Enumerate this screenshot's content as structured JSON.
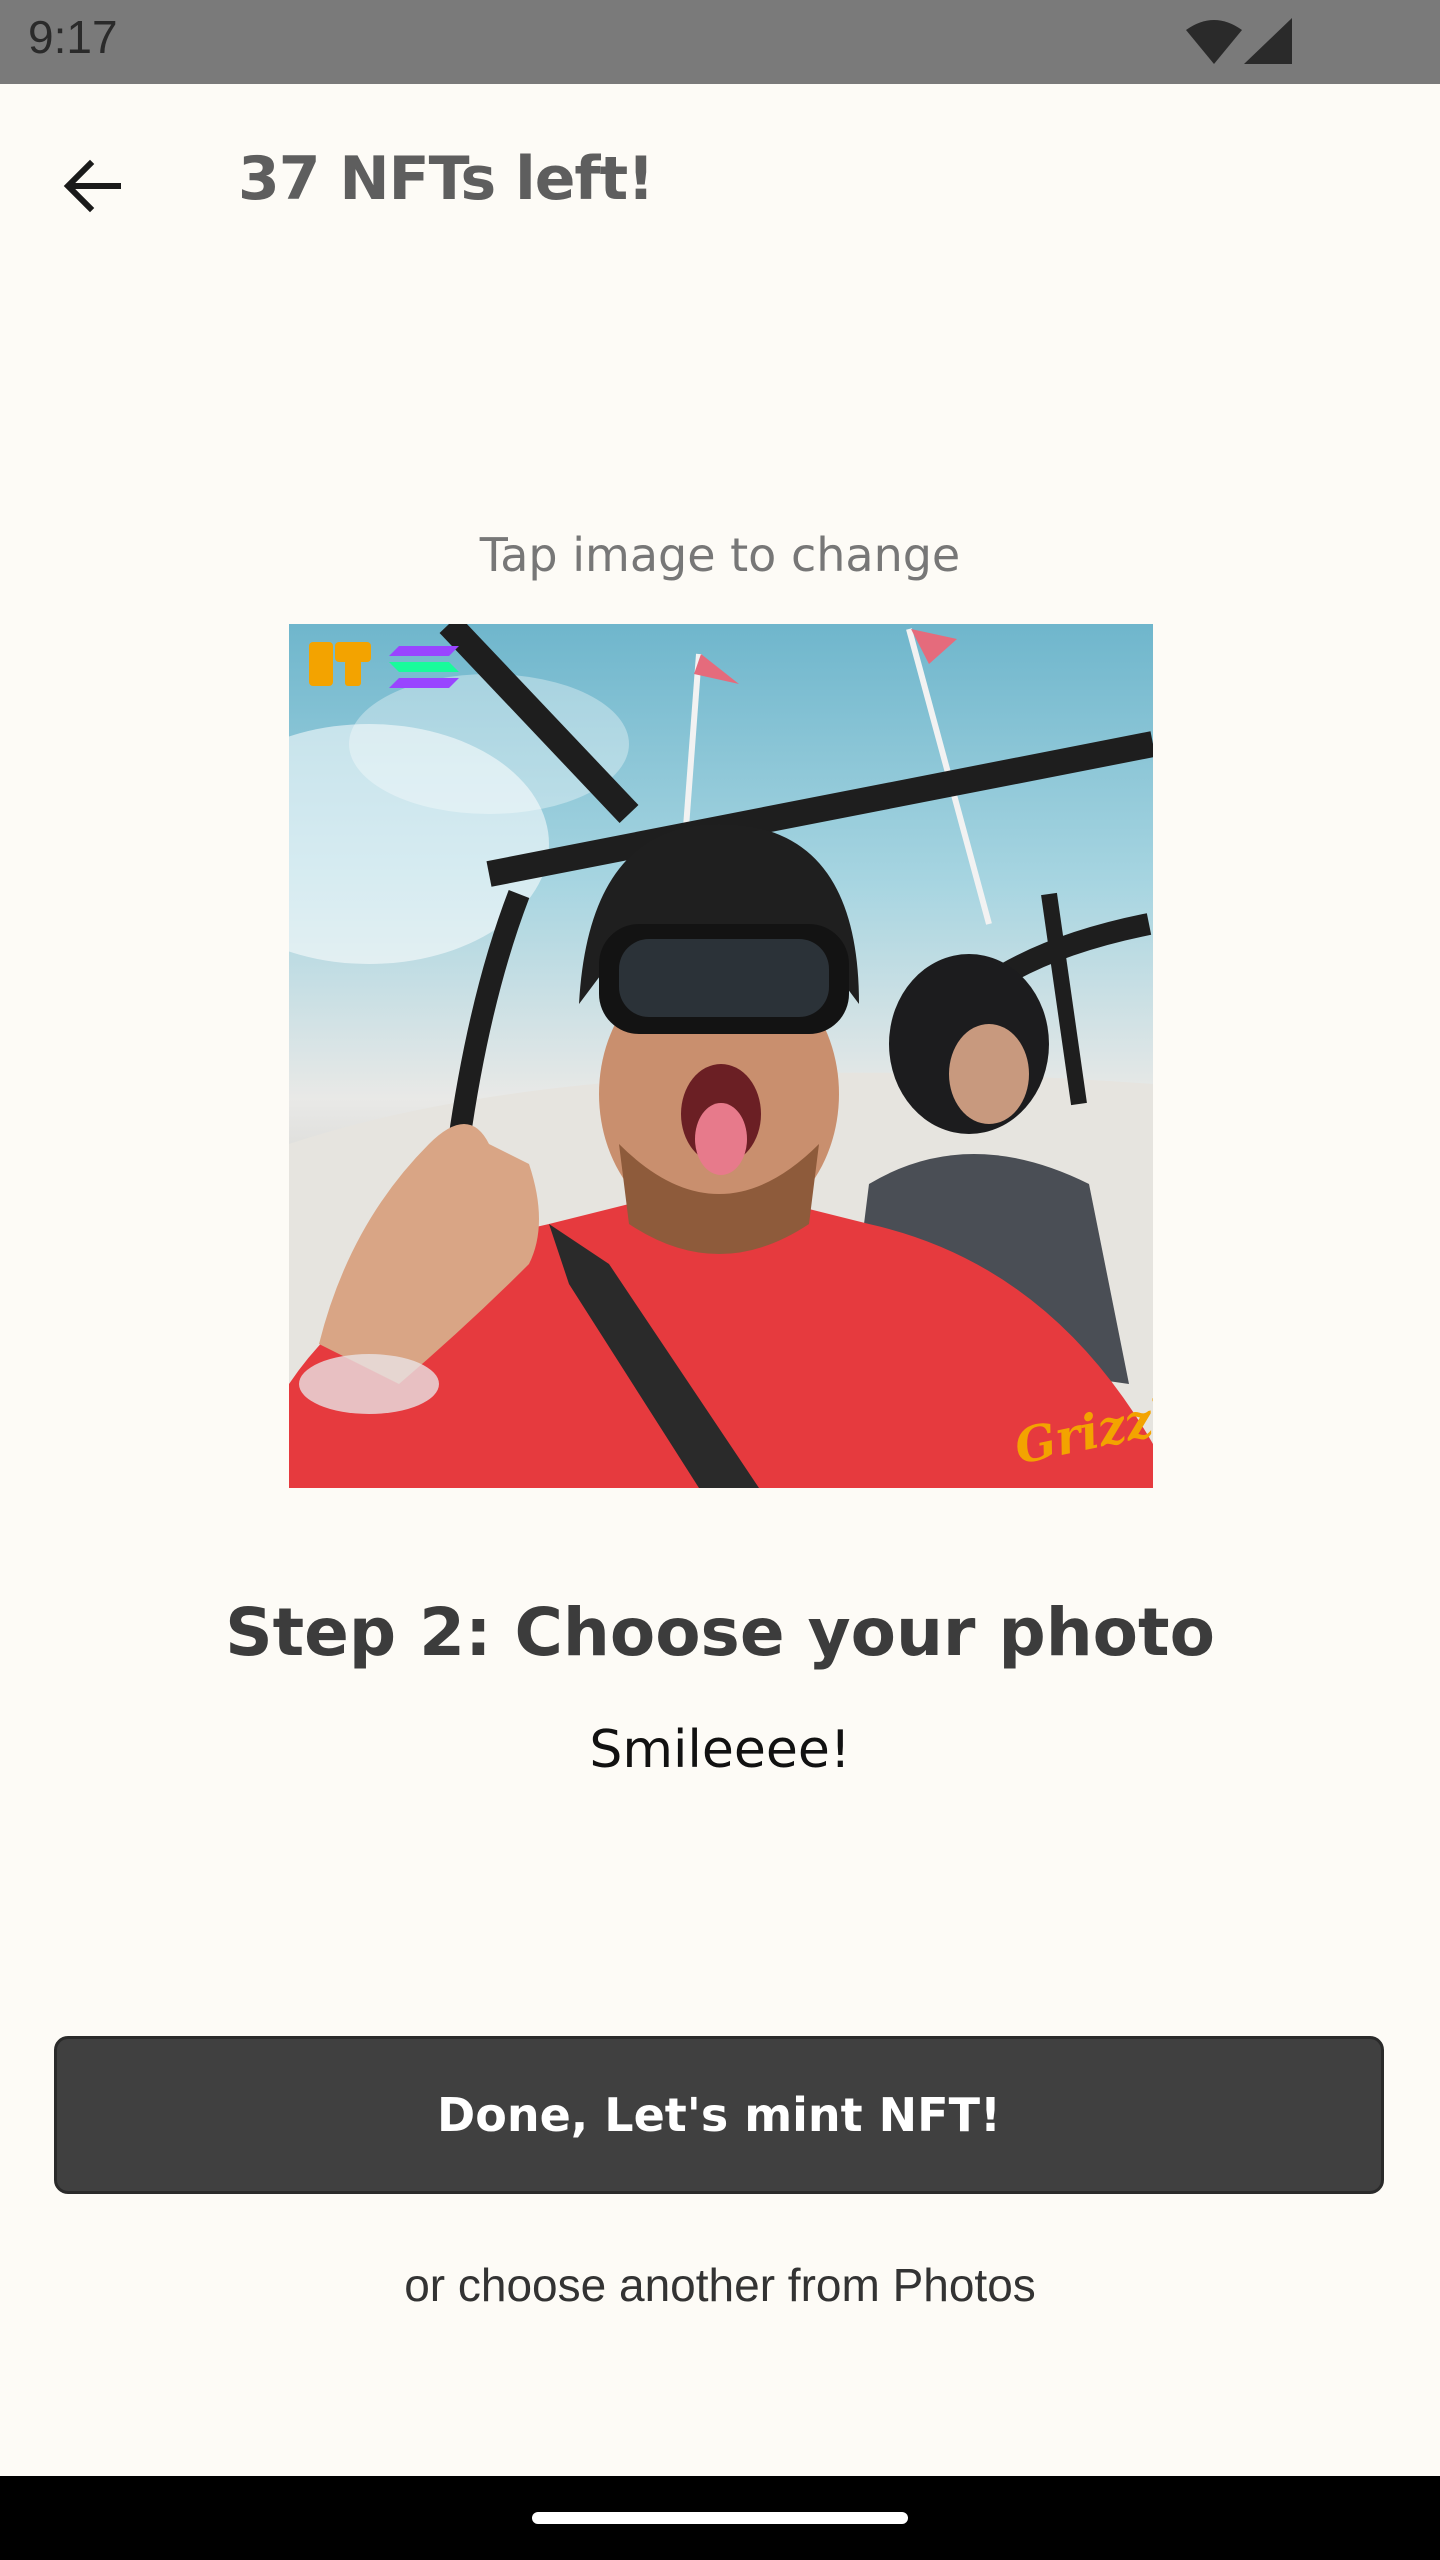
{
  "status_bar": {
    "time": "9:17",
    "wifi_icon": "wifi-icon",
    "signal_icon": "cell-signal-icon"
  },
  "header": {
    "back_icon": "arrow-left-icon",
    "title": "37 NFTs left!"
  },
  "hint": "Tap image to change",
  "photo": {
    "description_icon": "photo-image",
    "overlay_logo_left": "st-logo-icon",
    "overlay_logo_right": "solana-logo-icon",
    "watermark": "Grizzly"
  },
  "step": {
    "title": "Step 2: Choose your photo",
    "subtitle": "Smileeee!"
  },
  "actions": {
    "mint_label": "Done, Let's mint NFT!",
    "photos_link": "or choose another from Photos"
  },
  "colors": {
    "background": "#fdfbf6",
    "status_bar": "#7a7a7a",
    "button": "#404040",
    "title_text": "#5e5e5e"
  }
}
